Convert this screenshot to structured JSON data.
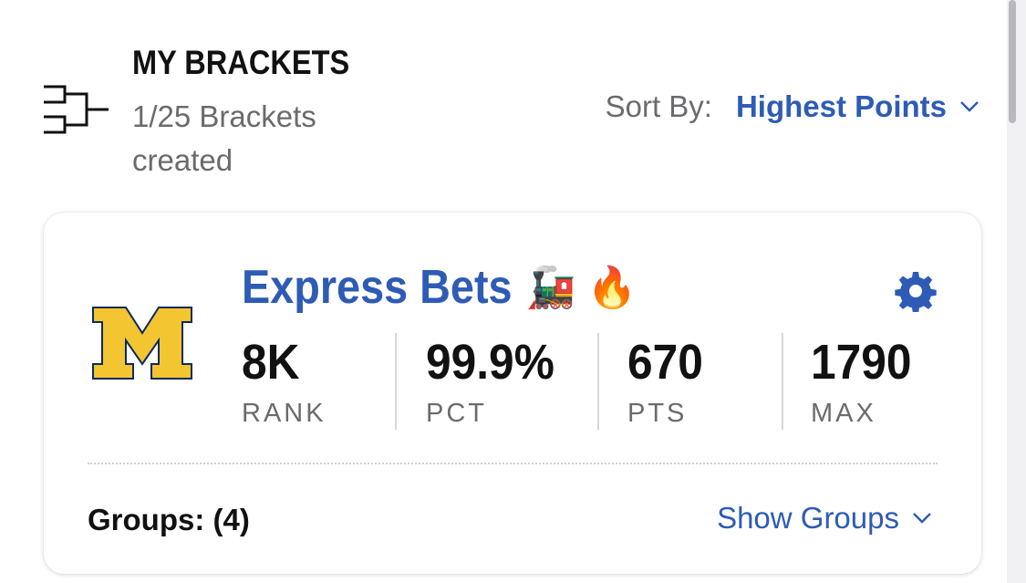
{
  "header": {
    "title": "MY BRACKETS",
    "subtitle": "1/25 Brackets created",
    "sort_label": "Sort By:",
    "sort_value": "Highest Points"
  },
  "bracket": {
    "name": "Express Bets",
    "emojis": "🚂 🔥",
    "team_logo": "michigan-block-m-logo",
    "stats": [
      {
        "value": "8K",
        "label": "RANK"
      },
      {
        "value": "99.9%",
        "label": "PCT"
      },
      {
        "value": "670",
        "label": "PTS"
      },
      {
        "value": "1790",
        "label": "MAX"
      }
    ],
    "groups_label": "Groups: (4)",
    "show_groups_label": "Show Groups"
  },
  "colors": {
    "accent": "#2e5bb5",
    "michigan_maize": "#f2c531",
    "michigan_blue": "#0b2a5c"
  },
  "icons": {
    "bracket": "bracket-icon",
    "gear": "gear-icon",
    "chevron": "chevron-down-icon"
  }
}
